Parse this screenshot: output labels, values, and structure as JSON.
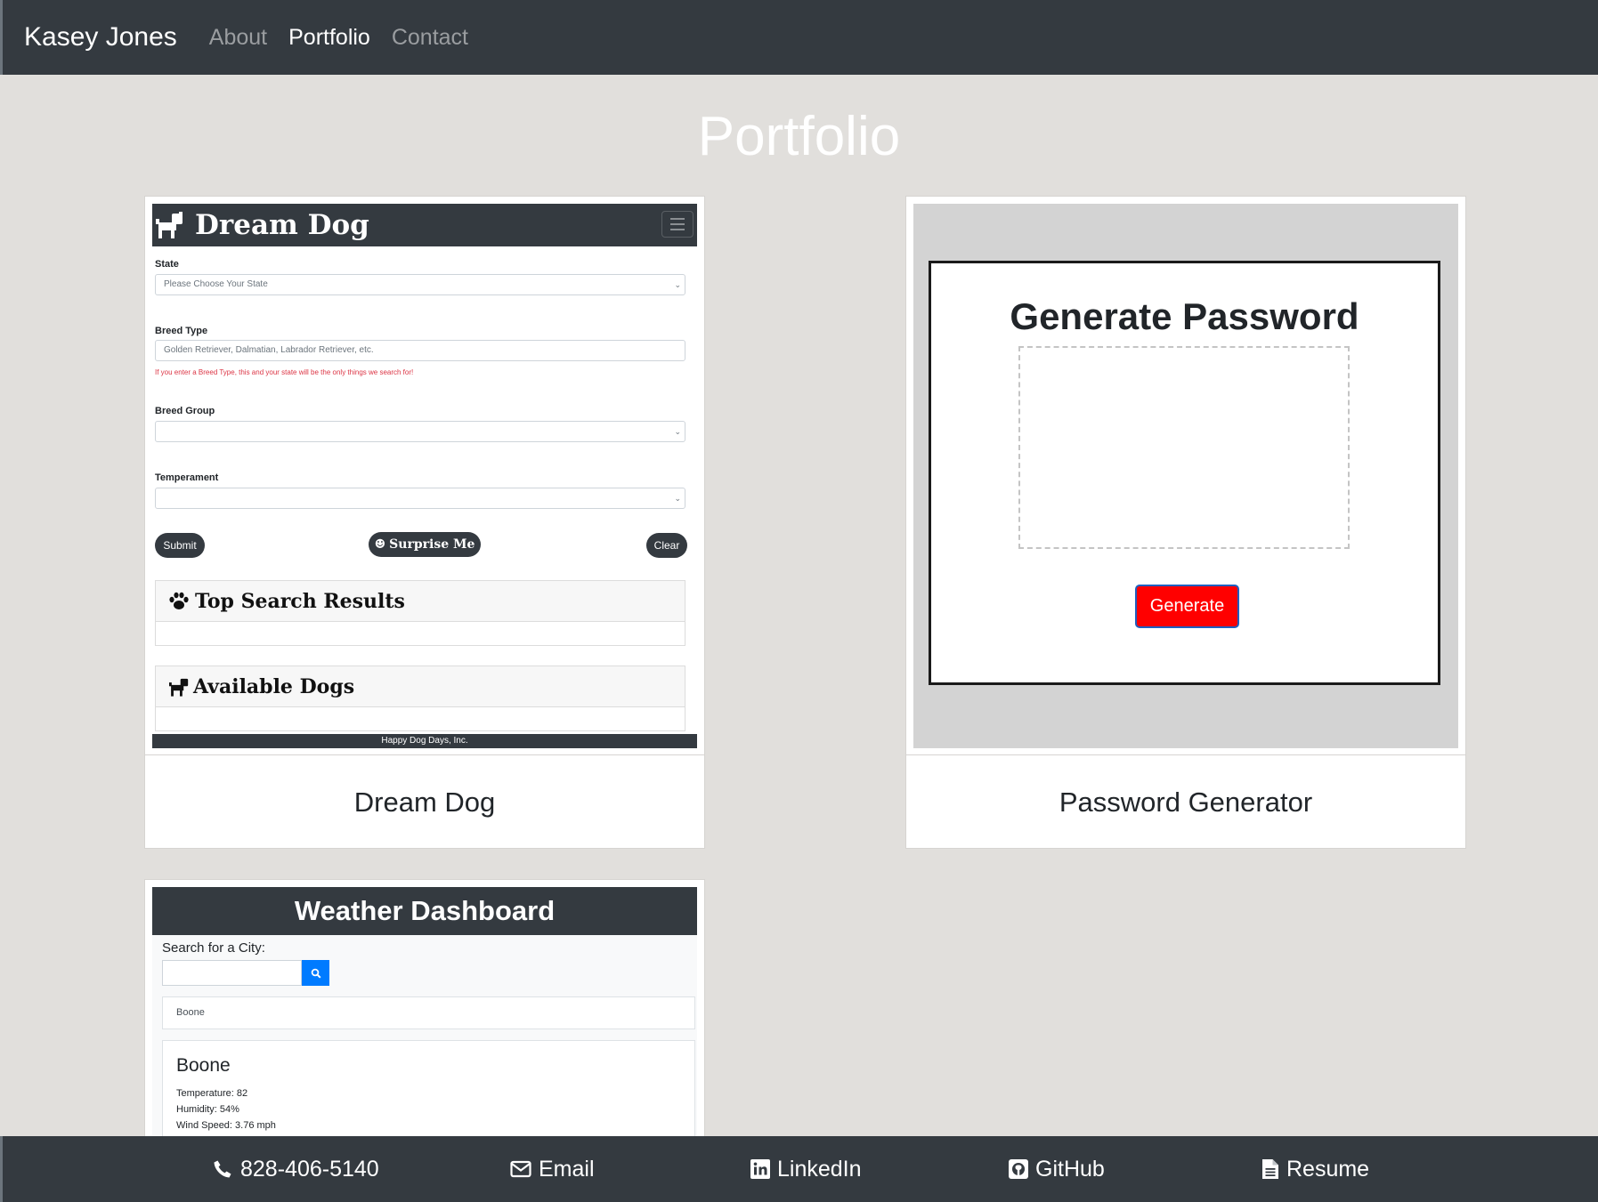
{
  "navbar": {
    "brand": "Kasey Jones",
    "links": [
      {
        "label": "About",
        "active": false
      },
      {
        "label": "Portfolio",
        "active": true
      },
      {
        "label": "Contact",
        "active": false
      }
    ]
  },
  "page": {
    "title": "Portfolio"
  },
  "projects": [
    {
      "title": "Dream Dog",
      "preview": {
        "app_title": "Dream Dog",
        "state_label": "State",
        "state_placeholder": "Please Choose Your State",
        "breed_type_label": "Breed Type",
        "breed_type_placeholder": "Golden Retriever, Dalmatian, Labrador Retriever, etc.",
        "breed_type_note": "If you enter a Breed Type, this and your state will be the only things we search for!",
        "breed_group_label": "Breed Group",
        "temperament_label": "Temperament",
        "submit_label": "Submit",
        "surprise_label": "Surprise Me",
        "clear_label": "Clear",
        "top_results_heading": "Top Search Results",
        "available_heading": "Available Dogs",
        "footer": "Happy Dog Days, Inc."
      }
    },
    {
      "title": "Password Generator",
      "preview": {
        "heading": "Generate Password",
        "button_label": "Generate",
        "button_color": "#ff0000"
      }
    },
    {
      "title": "Weather Dashboard",
      "preview": {
        "heading": "Weather Dashboard",
        "search_label": "Search for a City:",
        "history": [
          "Boone"
        ],
        "current": {
          "city": "Boone",
          "temperature": "Temperature: 82",
          "humidity": "Humidity: 54%",
          "wind": "Wind Speed: 3.76 mph"
        }
      }
    }
  ],
  "footer": {
    "links": [
      {
        "label": "828-406-5140",
        "icon": "phone-icon"
      },
      {
        "label": "Email",
        "icon": "envelope-icon"
      },
      {
        "label": "LinkedIn",
        "icon": "linkedin-icon"
      },
      {
        "label": "GitHub",
        "icon": "github-icon"
      },
      {
        "label": "Resume",
        "icon": "file-icon"
      }
    ]
  },
  "colors": {
    "navbar_bg": "#343a40",
    "page_bg": "#e1dfdc",
    "accent_red": "#ff0000",
    "accent_blue": "#007bff"
  }
}
